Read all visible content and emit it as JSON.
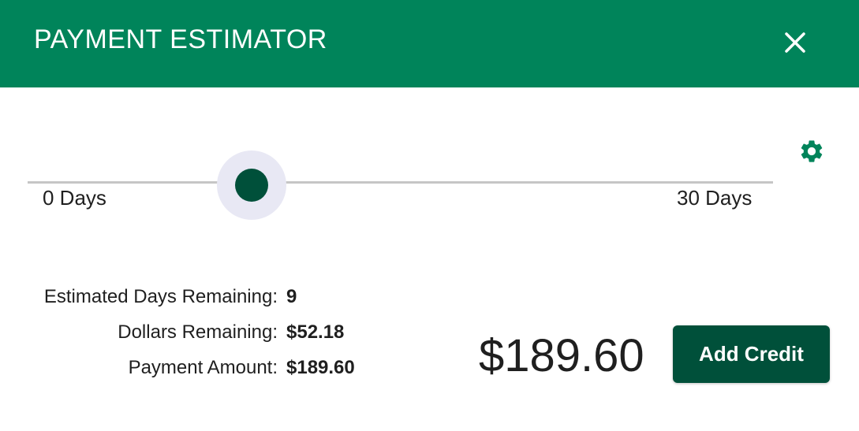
{
  "header": {
    "title": "PAYMENT ESTIMATOR",
    "close_icon": "close-icon"
  },
  "settings": {
    "icon": "gear-icon"
  },
  "slider": {
    "min_label": "0 Days",
    "max_label": "30 Days",
    "min": 0,
    "max": 30,
    "value": 9
  },
  "stats": [
    {
      "label": "Estimated Days Remaining:",
      "value": "9"
    },
    {
      "label": "Dollars Remaining:",
      "value": "$52.18"
    },
    {
      "label": "Payment Amount:",
      "value": "$189.60"
    }
  ],
  "amount_display": "$189.60",
  "add_credit_label": "Add Credit",
  "colors": {
    "header": "#00845a",
    "accent_dark": "#00503a",
    "gear": "#00845a",
    "halo": "#e8e8f4",
    "track": "#c6c6c6"
  }
}
